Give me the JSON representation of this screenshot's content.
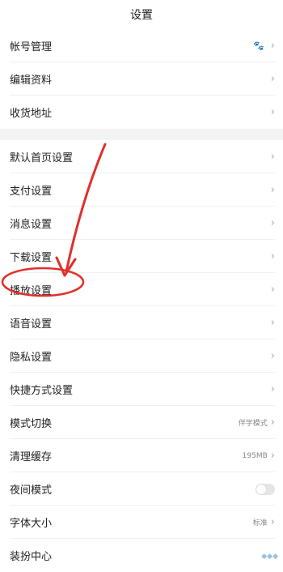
{
  "header": {
    "title": "设置"
  },
  "group1": [
    {
      "label": "帐号管理",
      "icon": "paw-icon"
    },
    {
      "label": "编辑资料"
    },
    {
      "label": "收货地址"
    }
  ],
  "group2": [
    {
      "label": "默认首页设置"
    },
    {
      "label": "支付设置"
    },
    {
      "label": "消息设置"
    },
    {
      "label": "下载设置"
    },
    {
      "label": "播放设置"
    },
    {
      "label": "语音设置"
    },
    {
      "label": "隐私设置"
    },
    {
      "label": "快捷方式设置"
    },
    {
      "label": "模式切换",
      "value": "伴学模式"
    },
    {
      "label": "清理缓存",
      "value": "195MB"
    },
    {
      "label": "夜间模式",
      "toggle": false
    },
    {
      "label": "字体大小",
      "value": "标准"
    },
    {
      "label": "装扮中心"
    }
  ],
  "annotation": {
    "arrow_color": "#e0302b"
  }
}
